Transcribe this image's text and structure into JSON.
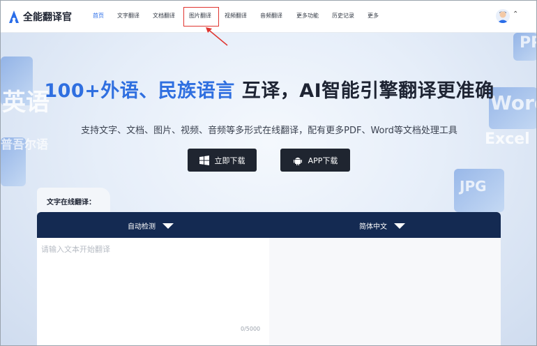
{
  "brand": {
    "name": "全能翻译官",
    "accent": "#2a6de8"
  },
  "nav": {
    "items": [
      {
        "label": "首页",
        "active": true
      },
      {
        "label": "文字翻译"
      },
      {
        "label": "文档翻译"
      },
      {
        "label": "图片翻译",
        "highlighted": true
      },
      {
        "label": "视频翻译"
      },
      {
        "label": "音频翻译"
      },
      {
        "label": "更多功能"
      },
      {
        "label": "历史记录"
      },
      {
        "label": "更多"
      }
    ]
  },
  "hero": {
    "headline_blue": "100+外语、民族语言",
    "headline_dark": " 互译，AI智能引擎翻译更准确",
    "subtitle": "支持文字、文档、图片、视频、音频等多形式在线翻译，配有更多PDF、Word等文档处理工具",
    "buttons": [
      {
        "label": "立即下载",
        "icon": "windows-icon"
      },
      {
        "label": "APP下载",
        "icon": "android-icon"
      }
    ],
    "decor": [
      "英语",
      "Word",
      "Excel",
      "JPG",
      "PPT",
      "普吾尔语"
    ]
  },
  "translator": {
    "tab_label": "文字在线翻译：",
    "source_lang": "自动检测",
    "target_lang": "简体中文",
    "placeholder": "请输入文本开始翻译",
    "counter": "0/5000",
    "header_color": "#142a52"
  }
}
